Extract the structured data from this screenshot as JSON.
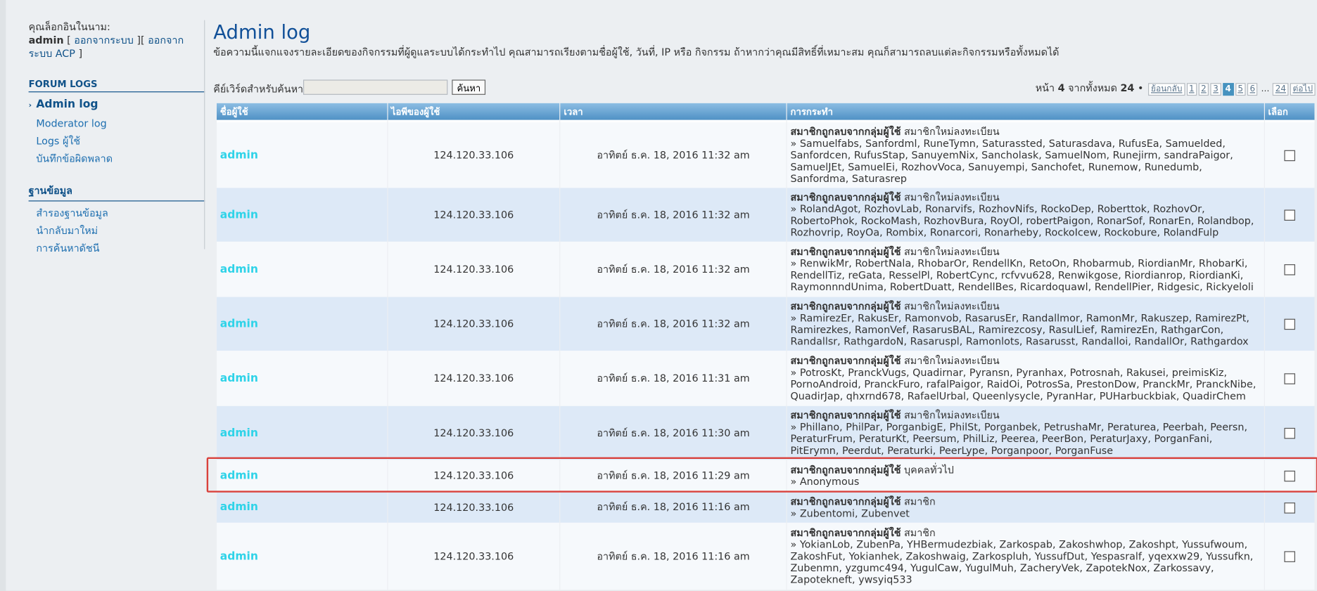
{
  "sidebar": {
    "login_prefix": "คุณล็อกอินในนาม:",
    "username": "admin",
    "logout_label": "ออกจากระบบ",
    "logout_acp_label": "ออกจากระบบ ACP",
    "sections": [
      {
        "title": "FORUM LOGS",
        "items": [
          {
            "label": "Admin log",
            "active": true
          },
          {
            "label": "Moderator log"
          },
          {
            "label": "Logs ผู้ใช้"
          },
          {
            "label": "บันทึกข้อผิดพลาด"
          }
        ]
      },
      {
        "title": "ฐานข้อมูล",
        "items": [
          {
            "label": "สำรองฐานข้อมูล"
          },
          {
            "label": "นำกลับมาใหม่"
          },
          {
            "label": "การค้นหาดัชนี"
          }
        ]
      }
    ]
  },
  "main": {
    "title": "Admin log",
    "intro": "ข้อความนี้แจกแจงรายละเอียดของกิจกรรมที่ผู้ดูแลระบบได้กระทำไป คุณสามารถเรียงตามชื่อผู้ใช้, วันที่, IP หรือ กิจกรรม ถ้าหากว่าคุณมีสิทธิ์ที่เหมาะสม คุณก็สามารถลบแต่ละกิจกรรมหรือทั้งหมดได้",
    "search": {
      "label": "คีย์เวิร์ดสำหรับค้นหา:",
      "value": "",
      "button": "ค้นหา"
    },
    "pager": {
      "prefix": "หน้า",
      "current": "4",
      "of": "จากทั้งหมด",
      "total": "24",
      "prev": "ย้อนกลับ",
      "pages": [
        "1",
        "2",
        "3",
        "4",
        "5",
        "6",
        "…",
        "24"
      ],
      "next": "ต่อไป"
    }
  },
  "table": {
    "headers": [
      "ชื่อผู้ใช้",
      "ไอพีของผู้ใช้",
      "เวลา",
      "การกระทำ",
      "เลือก"
    ],
    "rows": [
      {
        "user": "admin",
        "ip": "124.120.33.106",
        "time": "อาทิตย์ ธ.ค. 18, 2016 11:32 am",
        "action_bold": "สมาชิกถูกลบจากกลุ่มผู้ใช้",
        "action_group": "สมาชิกใหม่ลงทะเบียน",
        "action_detail": "» Samuelfabs, Sanfordml, RuneTymn, Saturassted, Saturasdava, RufusEa, Samuelded, Sanfordcen, RufusStap, SanuyemNix, Sancholask, SamuelNom, Runejirm, sandraPaigor, SamuelJEt, SamuelEi, RozhovVoca, Sanuyempi, Sanchofet, Runemow, Runedumb, Sanfordma, Saturasrep",
        "height": 78
      },
      {
        "user": "admin",
        "ip": "124.120.33.106",
        "time": "อาทิตย์ ธ.ค. 18, 2016 11:32 am",
        "action_bold": "สมาชิกถูกลบจากกลุ่มผู้ใช้",
        "action_group": "สมาชิกใหม่ลงทะเบียน",
        "action_detail": "» RolandAgot, RozhovLab, Ronarvifs, RozhovNifs, RockoDep, Roberttok, RozhovOr, RobertoPhok, RockoMash, RozhovBura, RoyOl, robertPaigon, RonarSof, RonarEn, Rolandbop, Rozhovrip, RoyOa, Rombix, Ronarcori, Ronarheby, RockoIcew, Rockobure, RolandFulp",
        "height": 64
      },
      {
        "user": "admin",
        "ip": "124.120.33.106",
        "time": "อาทิตย์ ธ.ค. 18, 2016 11:32 am",
        "action_bold": "สมาชิกถูกลบจากกลุ่มผู้ใช้",
        "action_group": "สมาชิกใหม่ลงทะเบียน",
        "action_detail": "» RenwikMr, RobertNala, RhobarOr, RendellKn, RetoOn, Rhobarmub, RiordianMr, RhobarKi, RendellTiz, reGata, ResselPl, RobertCync, rcfvvu628, Renwikgose, Riordianrop, RiordianKi, RaymonnndUnima, RobertDuatt, RendellBes, Ricardoquawl, RendellPier, Ridgesic, Rickyeloli",
        "height": 66
      },
      {
        "user": "admin",
        "ip": "124.120.33.106",
        "time": "อาทิตย์ ธ.ค. 18, 2016 11:32 am",
        "action_bold": "สมาชิกถูกลบจากกลุ่มผู้ใช้",
        "action_group": "สมาชิกใหม่ลงทะเบียน",
        "action_detail": "» RamirezEr, RakusEr, Ramonvob, RasarusEr, Randallmor, RamonMr, Rakuszep, RamirezPt, Ramirezkes, RamonVef, RasarusBAL, Ramirezcosy, RasulLief, RamirezEn, RathgarCon, Randallsr, RathgardoN, Rasaruspl, Ramonlots, Rasarusst, Randalloi, RandallOr, Rathgardox",
        "height": 64
      },
      {
        "user": "admin",
        "ip": "124.120.33.106",
        "time": "อาทิตย์ ธ.ค. 18, 2016 11:31 am",
        "action_bold": "สมาชิกถูกลบจากกลุ่มผู้ใช้",
        "action_group": "สมาชิกใหม่ลงทะเบียน",
        "action_detail": "» PotrosKt, PranckVugs, Quadirnar, Pyransn, Pyranhax, Potrosnah, Rakusei, preimisKiz, PornoAndroid, PranckFuro, rafalPaigor, RaidOi, PotrosSa, PrestonDow, PranckMr, PranckNibe, QuadirJap, qhxrnd678, RafaelUrbal, Queenlysycle, PyranHar, PUHarbuckbiak, QuadirChem",
        "height": 66
      },
      {
        "user": "admin",
        "ip": "124.120.33.106",
        "time": "อาทิตย์ ธ.ค. 18, 2016 11:30 am",
        "action_bold": "สมาชิกถูกลบจากกลุ่มผู้ใช้",
        "action_group": "สมาชิกใหม่ลงทะเบียน",
        "action_detail": "» Phillano, PhilPar, PorganbigE, PhilSt, Porganbek, PetrushaMr, Peraturea, Peerbah, Peersn, PeraturFrum, PeraturKt, Peersum, PhilLiz, Peerea, PeerBon, PeraturJaxy, PorganFani, PitErymn, Peerdut, Peraturki, PeerLype, Porganpoor, PorganFuse",
        "height": 64
      },
      {
        "user": "admin",
        "ip": "124.120.33.106",
        "time": "อาทิตย์ ธ.ค. 18, 2016 11:29 am",
        "action_bold": "สมาชิกถูกลบจากกลุ่มผู้ใช้",
        "action_group": "บุคคลทั่วไป",
        "action_detail": "» Anonymous",
        "height": 38
      },
      {
        "user": "admin",
        "ip": "124.120.33.106",
        "time": "อาทิตย์ ธ.ค. 18, 2016 11:16 am",
        "action_bold": "สมาชิกถูกลบจากกลุ่มผู้ใช้",
        "action_group": "สมาชิก",
        "action_detail": "» Zubentomi, Zubenvet",
        "height": 37
      },
      {
        "user": "admin",
        "ip": "124.120.33.106",
        "time": "อาทิตย์ ธ.ค. 18, 2016 11:16 am",
        "action_bold": "สมาชิกถูกลบจากกลุ่มผู้ใช้",
        "action_group": "สมาชิก",
        "action_detail": "» YokianLob, ZubenPa, YHBermudezbiak, Zarkospab, Zakoshwhop, Zakoshpt, Yussufwoum, ZakoshFut, Yokianhek, Zakoshwaig, Zarkospluh, YussufDut, Yespasralf, yqexxw29, Yussufkn, Zubenmn, yzgumc494, YugulCaw, YugulMuh, ZacheryVek, ZapotekNox, Zarkossavy, Zapotekneft, ywsyiq533",
        "height": 80
      }
    ]
  },
  "colors": {
    "header_blue": "#4f91c5",
    "row_light": "#f6f9fc",
    "row_blue": "#dde9f7",
    "user_link": "#2fd3e8",
    "title_blue": "#115098",
    "highlight_red": "#d9413c"
  }
}
